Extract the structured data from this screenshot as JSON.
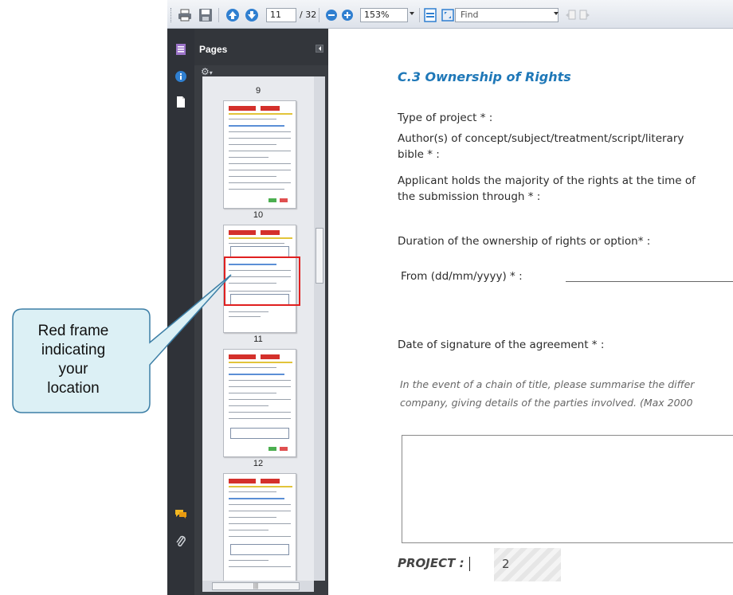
{
  "toolbar": {
    "page_current": "11",
    "page_total": "/ 32",
    "zoom": "153%",
    "find_placeholder": "Find"
  },
  "pages_panel": {
    "title": "Pages",
    "thumbnails": [
      {
        "label": "9"
      },
      {
        "label": "10"
      },
      {
        "label": "11"
      },
      {
        "label": "12"
      }
    ]
  },
  "document": {
    "section_title": "C.3 Ownership of Rights",
    "lines": [
      "Type of project * :",
      "Author(s) of concept/subject/treatment/script/literary",
      "bible * :",
      "Applicant holds the majority of the rights at the time of",
      "the submission through * :",
      "Duration of the ownership of rights or option* :",
      "From (dd/mm/yyyy) * :",
      "Date of signature of the agreement * :"
    ],
    "chain_note": [
      "In the event of a chain of title, please summarise the differ",
      "company, giving details of the parties involved. (Max 2000"
    ],
    "project_label": "PROJECT :",
    "project_value": "2"
  },
  "callout": {
    "lines": [
      "Red frame",
      "indicating",
      "your",
      "location"
    ],
    "fill": "#dcf0f5",
    "stroke": "#3d7fa6"
  },
  "colors": {
    "accent_title": "#1f78b8",
    "location_frame": "#e02020"
  }
}
